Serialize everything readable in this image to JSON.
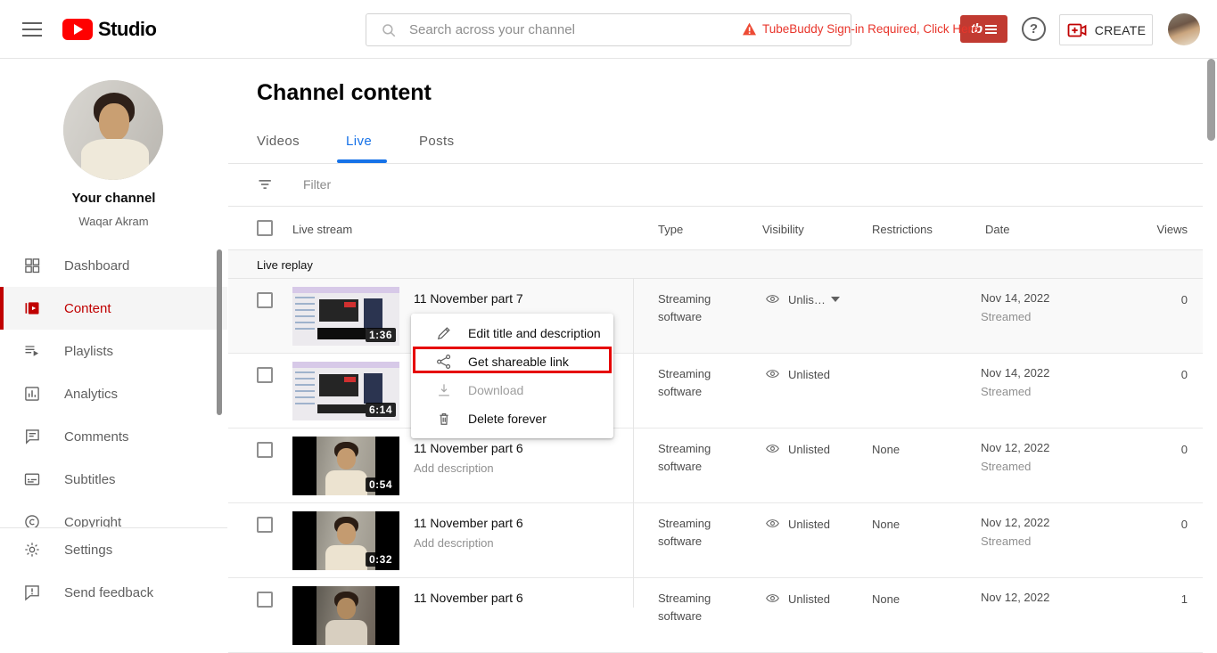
{
  "topbar": {
    "brand": "Studio",
    "search_placeholder": "Search across your channel",
    "warning_text": "TubeBuddy Sign-in Required, Click Here",
    "tb_logo": "tb",
    "help_glyph": "?",
    "create_label": "CREATE"
  },
  "sidebar": {
    "channel_label": "Your channel",
    "channel_name": "Waqar Akram",
    "items": [
      {
        "label": "Dashboard"
      },
      {
        "label": "Content"
      },
      {
        "label": "Playlists"
      },
      {
        "label": "Analytics"
      },
      {
        "label": "Comments"
      },
      {
        "label": "Subtitles"
      },
      {
        "label": "Copyright"
      }
    ],
    "footer": [
      {
        "label": "Settings"
      },
      {
        "label": "Send feedback"
      }
    ]
  },
  "content": {
    "title": "Channel content",
    "tabs": [
      {
        "label": "Videos",
        "active": false
      },
      {
        "label": "Live",
        "active": true
      },
      {
        "label": "Posts",
        "active": false
      }
    ],
    "filter_label": "Filter",
    "columns": {
      "live_stream": "Live stream",
      "type": "Type",
      "visibility": "Visibility",
      "restrictions": "Restrictions",
      "date": "Date",
      "views": "Views"
    },
    "section_label": "Live replay",
    "rows": [
      {
        "title": "11 November part 7",
        "duration": "1:36",
        "type": "Streaming software",
        "visibility": "Unlis…",
        "restrictions": "",
        "date": "Nov 14, 2022",
        "date_sub": "Streamed",
        "views": "0"
      },
      {
        "title": "",
        "duration": "6:14",
        "type": "Streaming software",
        "visibility": "Unlisted",
        "restrictions": "",
        "date": "Nov 14, 2022",
        "date_sub": "Streamed",
        "views": "0"
      },
      {
        "title": "11 November part 6",
        "description": "Add description",
        "duration": "0:54",
        "type": "Streaming software",
        "visibility": "Unlisted",
        "restrictions": "None",
        "date": "Nov 12, 2022",
        "date_sub": "Streamed",
        "views": "0"
      },
      {
        "title": "11 November part 6",
        "description": "Add description",
        "duration": "0:32",
        "type": "Streaming software",
        "visibility": "Unlisted",
        "restrictions": "None",
        "date": "Nov 12, 2022",
        "date_sub": "Streamed",
        "views": "0"
      },
      {
        "title": "11 November part 6",
        "type": "Streaming software",
        "visibility": "Unlisted",
        "restrictions": "None",
        "date": "Nov 12, 2022",
        "views": "1"
      }
    ]
  },
  "context_menu": {
    "items": [
      {
        "label": "Edit title and description"
      },
      {
        "label": "Get shareable link",
        "highlighted": true
      },
      {
        "label": "Download",
        "disabled": true
      },
      {
        "label": "Delete forever"
      }
    ]
  },
  "colors": {
    "brand_red": "#ff0000",
    "active_nav_red": "#cc0000",
    "tab_active_blue": "#1672e8",
    "warning_red": "#e8352b",
    "tubebuddy_red": "#c13a31",
    "highlight_box_red": "#e60000"
  }
}
